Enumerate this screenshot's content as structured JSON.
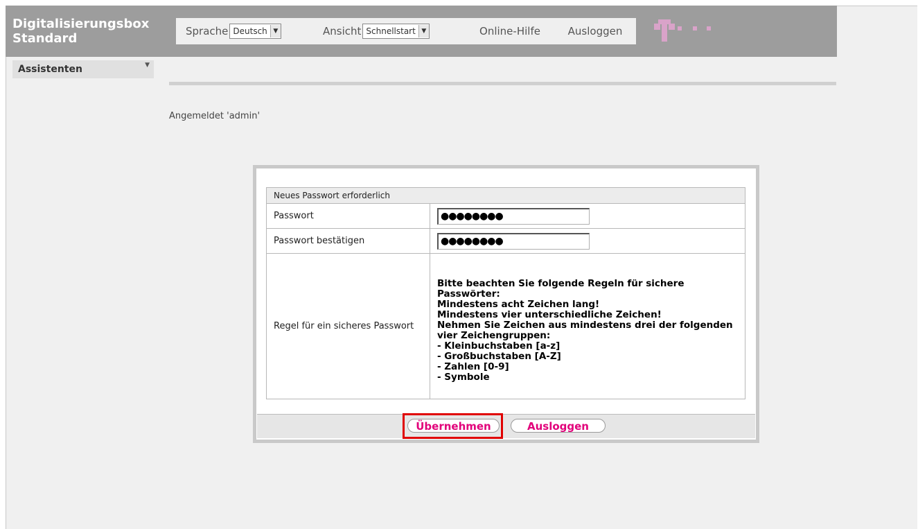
{
  "header": {
    "title_line1": "Digitalisierungsbox",
    "title_line2": "Standard",
    "language_label": "Sprache",
    "language_value": "Deutsch",
    "view_label": "Ansicht",
    "view_value": "Schnellstart",
    "help_label": "Online-Hilfe",
    "logout_label": "Ausloggen",
    "brand_color": "#e2007a"
  },
  "sidebar": {
    "label": "Assistenten"
  },
  "status": {
    "logged_in": "Angemeldet 'admin'"
  },
  "dialog": {
    "caption": "Neues Passwort erforderlich",
    "password_label": "Passwort",
    "password_value": "●●●●●●●●",
    "confirm_label": "Passwort bestätigen",
    "confirm_value": "●●●●●●●●",
    "rule_label": "Regel für ein sicheres Passwort",
    "rules": [
      "Bitte beachten Sie folgende Regeln für sichere Passwörter:",
      "Mindestens acht Zeichen lang!",
      "Mindestens vier unterschiedliche Zeichen!",
      "Nehmen Sie Zeichen aus mindestens drei der folgenden vier Zeichengruppen:",
      "- Kleinbuchstaben [a-z]",
      "- Großbuchstaben [A-Z]",
      "- Zahlen [0-9]",
      "- Symbole"
    ],
    "apply_button": "Übernehmen",
    "logout_button": "Ausloggen"
  }
}
